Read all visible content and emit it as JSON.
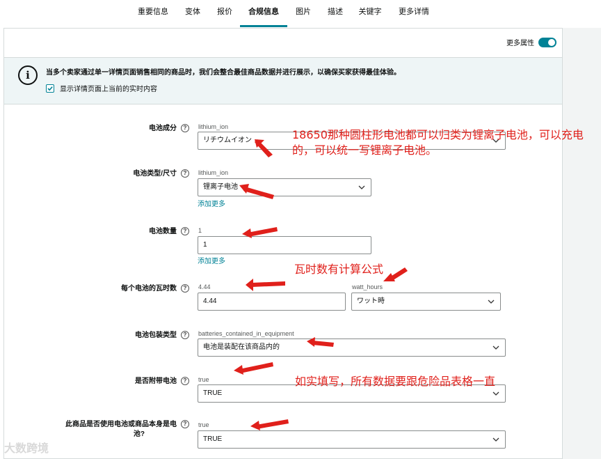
{
  "tabs": [
    "重要信息",
    "变体",
    "报价",
    "合规信息",
    "图片",
    "描述",
    "关键字",
    "更多详情"
  ],
  "active_tab": "合规信息",
  "more_attributes_label": "更多属性",
  "info": {
    "text": "当多个卖家通过单一详情页面销售相同的商品时，我们会整合最佳商品数据并进行展示，以确保买家获得最佳体验。",
    "checkbox_label": "显示详情页面上当前的实时内容"
  },
  "form": {
    "battery_composition": {
      "label": "电池成分",
      "hint": "lithium_ion",
      "value": "リチウムイオン"
    },
    "battery_type": {
      "label": "电池类型/尺寸",
      "hint": "lithium_ion",
      "value": "锂离子电池",
      "add_more": "添加更多"
    },
    "battery_count": {
      "label": "电池数量",
      "hint": "1",
      "value": "1",
      "add_more": "添加更多"
    },
    "watt_hours": {
      "label": "每个电池的瓦时数",
      "hint": "4.44",
      "value": "4.44",
      "unit_hint": "watt_hours",
      "unit_value": "ワット時"
    },
    "battery_packaging": {
      "label": "电池包装类型",
      "hint": "batteries_contained_in_equipment",
      "value": "电池是装配在该商品内的"
    },
    "batteries_included": {
      "label": "是否附带电池",
      "hint": "true",
      "value": "TRUE"
    },
    "batteries_required": {
      "label_line1": "此商品是否使用电池或商品本身是电",
      "label_line2": "池?",
      "hint": "true",
      "value": "TRUE"
    }
  },
  "annotations": {
    "note1_line1": "18650那种圆柱形电池都可以归类为锂离子电池，可以充电",
    "note1_line2": "的，可以统一写锂离子电池。",
    "note2": "瓦时数有计算公式",
    "note3": "如实填写，所有数据要跟危险品表格一直"
  },
  "watermark": "大数跨境",
  "colors": {
    "accent": "#008296",
    "annotation": "#e0201b",
    "info_bg": "#eef5f6"
  },
  "icons": {
    "info": "info-icon",
    "help": "help-icon",
    "chevron": "chevron-down-icon",
    "check": "check-icon"
  }
}
